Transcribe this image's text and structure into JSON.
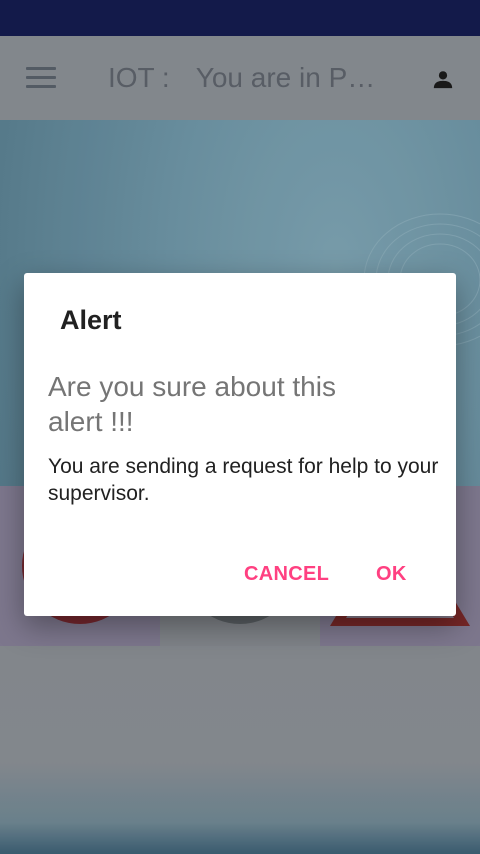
{
  "app_bar": {
    "title": "IOT :",
    "subtitle": "You are in P…"
  },
  "dialog": {
    "title": "Alert",
    "heading": "Are you sure about this alert !!!",
    "message": "You are sending a request for help to your supervisor.",
    "cancel_label": "CANCEL",
    "ok_label": "OK"
  },
  "icons": {
    "menu": "menu-icon",
    "profile": "person-icon"
  },
  "colors": {
    "status_bar": "#131a4a",
    "accent": "#ff4081"
  }
}
